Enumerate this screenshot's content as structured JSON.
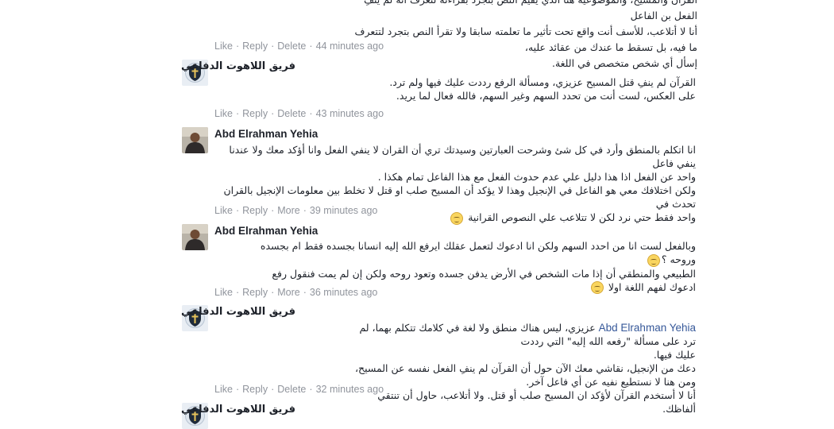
{
  "top_fragment": {
    "lines": [
      "القرآن والمسيح، والموضوعية هنا الذي يقيّم النص بتجرد بقراءته لتعرف أنه لم ينفِ الفعل بن الفاعل",
      "أنا لا أتلاعب، للأسف أنت واقع تحت تأثير ما تعلمته سابقا ولا تقرأ النص بتجرد لتتعرف ما فيه، بل تسقط ما عندك من عقائد عليه،",
      "إسأل أي شخص متخصص في اللغة."
    ],
    "actions": {
      "like": "Like",
      "reply": "Reply",
      "delete": "Delete",
      "time": "44 minutes ago"
    }
  },
  "comments": [
    {
      "author": "فريق اللاهوت الدفاعي",
      "avatar": "shield-avatar",
      "lines": [
        "القرآن لم ينفِ قتل المسيح عزيزي، ومسألة الرفع رددت عليك فيها ولم ترد.",
        "على العكس، لست أنت من تحدد السهم وغير السهم، فالله فعال لما يريد."
      ],
      "actions": {
        "like": "Like",
        "reply": "Reply",
        "delete": "Delete",
        "time": "43 minutes ago"
      }
    },
    {
      "author": "Abd Elrahman Yehia",
      "avatar": "user-avatar",
      "lines": [
        "انا اتكلم بالمنطق وأرد في كل شئ وشرحت العبارتين وسيدتك تري أن القران لا ينفي الفعل وانا أؤكد معك ولا عندنا ينفي فاعل",
        "واحد عن الفعل اذا هذا دليل علي عدم حدوث الفعل مع هذا الفاعل تمام هكذا .",
        "ولكن اختلافك معي هو الفاعل في الإنجيل وهذا لا يؤكد أن المسيح صلب او قتل لا تخلط بين معلومات الإنجيل بالقران تحدث في",
        "واحد فقط حتي نرد لكن لا تتلاعب علي النصوص القرانية"
      ],
      "actions": {
        "like": "Like",
        "reply": "Reply",
        "more": "More",
        "time": "39 minutes ago"
      }
    },
    {
      "author": "Abd Elrahman Yehia",
      "avatar": "user-avatar",
      "lines": [
        "وبالفعل لست انا من احدد السهم ولكن انا ادعوك لتعمل عقلك ايرفع الله إليه انسانا بجسده فقط ام بجسده وروحه ؟",
        "الطبيعي والمنطقي أن إذا مات الشخص في الأرض يدفن جسده وتعود روحه ولكن إن لم يمت فنقول رفع",
        "ادعوك لفهم اللغة اولا"
      ],
      "actions": {
        "like": "Like",
        "reply": "Reply",
        "more": "More",
        "time": "36 minutes ago"
      }
    },
    {
      "author": "فريق اللاهوت الدفاعي",
      "avatar": "shield-avatar",
      "mention": "Abd Elrahman Yehia",
      "lines": [
        "عزيزي، ليس هناك منطق ولا لغة في كلامك تتكلم بهما، لم ترد على مسألة \"رفعه الله إليه\" التي رددت",
        "عليك فيها.",
        "دعك من الإنجيل، نقاشي معك الآن حول أن القرآن لم ينفِ الفعل نفسه عن المسيح، ومن هنا لا نستطيع نفيه عن أي فاعل آخر.",
        "أنا لا أستخدم القرآن لأؤكد ان المسيح صلب أو قتل. ولا أتلاعب، حاول أن تنتقي ألفاظك."
      ],
      "actions": {
        "like": "Like",
        "reply": "Reply",
        "delete": "Delete",
        "time": "32 minutes ago"
      }
    },
    {
      "author": "فريق اللاهوت الدفاعي",
      "avatar": "shield-avatar"
    }
  ],
  "colors": {
    "link": "#365899",
    "meta": "#90949c",
    "text": "#1d2129"
  }
}
